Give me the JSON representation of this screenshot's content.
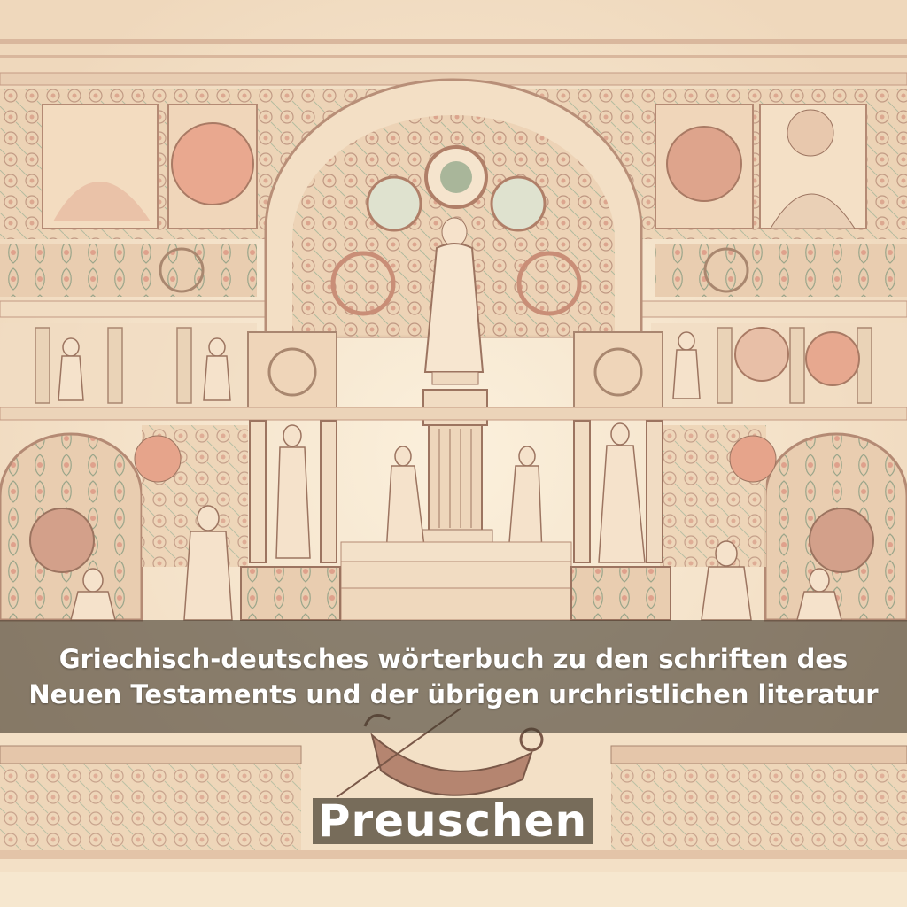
{
  "cover": {
    "title": "Griechisch-deutsches wörterbuch zu den schriften des Neuen Testaments und der übrigen urchristlichen literatur",
    "author": "Preuschen"
  },
  "colors": {
    "parchment": "#f6e6c9",
    "rose": "#e2a690",
    "sage": "#a9b69a",
    "ink": "#8a6a58",
    "band": "#463e30"
  }
}
